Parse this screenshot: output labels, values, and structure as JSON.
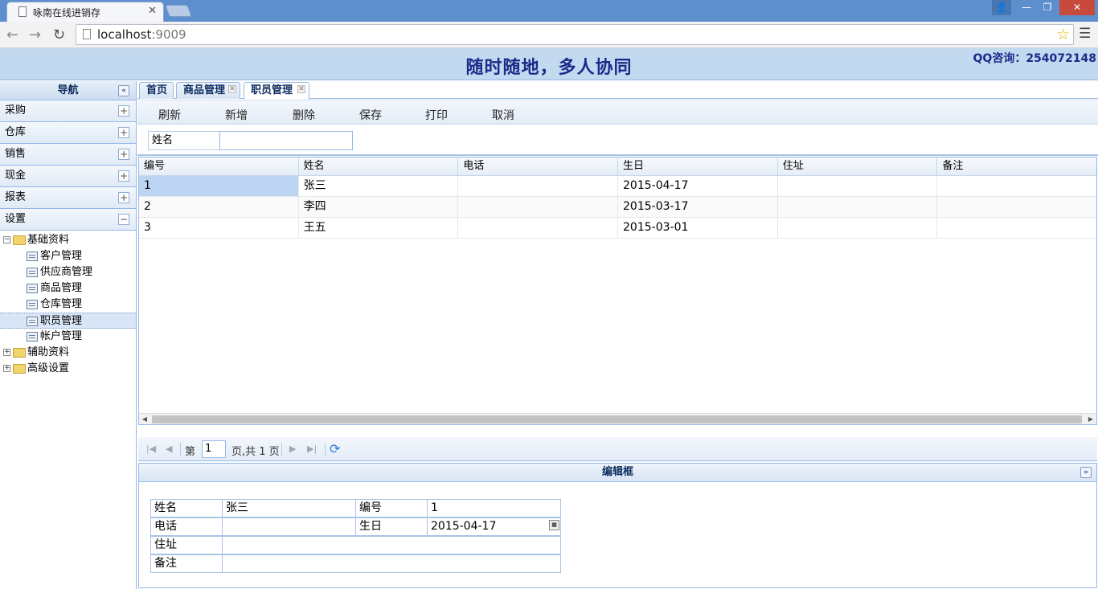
{
  "browser": {
    "tab_title": "咏南在线进销存",
    "url_host": "localhost",
    "url_port": ":9009"
  },
  "header": {
    "title": "随时随地，多人协同",
    "qq": "QQ咨询：254072148"
  },
  "sidebar": {
    "title": "导航",
    "sections": [
      {
        "label": "采购",
        "toggle": "+"
      },
      {
        "label": "仓库",
        "toggle": "+"
      },
      {
        "label": "销售",
        "toggle": "+"
      },
      {
        "label": "现金",
        "toggle": "+"
      },
      {
        "label": "报表",
        "toggle": "+"
      },
      {
        "label": "设置",
        "toggle": "−"
      }
    ],
    "tree": {
      "basic": "基础资料",
      "basic_items": [
        "客户管理",
        "供应商管理",
        "商品管理",
        "仓库管理",
        "职员管理",
        "帐户管理"
      ],
      "aux": "辅助资料",
      "advanced": "高级设置"
    }
  },
  "tabs": [
    "首页",
    "商品管理",
    "职员管理"
  ],
  "actions": [
    "刷新",
    "新增",
    "删除",
    "保存",
    "打印",
    "取消"
  ],
  "search": {
    "label": "姓名",
    "value": ""
  },
  "grid": {
    "columns": [
      "编号",
      "姓名",
      "电话",
      "生日",
      "住址",
      "备注"
    ],
    "rows": [
      [
        "1",
        "张三",
        "",
        "2015-04-17",
        "",
        ""
      ],
      [
        "2",
        "李四",
        "",
        "2015-03-17",
        "",
        ""
      ],
      [
        "3",
        "王五",
        "",
        "2015-03-01",
        "",
        ""
      ]
    ]
  },
  "pager": {
    "prefix": "第",
    "page": "1",
    "suffix": "页,共 1 页"
  },
  "editor": {
    "title": "编辑框",
    "name_label": "姓名",
    "name_value": "张三",
    "id_label": "编号",
    "id_value": "1",
    "phone_label": "电话",
    "phone_value": "",
    "birthday_label": "生日",
    "birthday_value": "2015-04-17",
    "address_label": "住址",
    "address_value": "",
    "note_label": "备注",
    "note_value": ""
  }
}
